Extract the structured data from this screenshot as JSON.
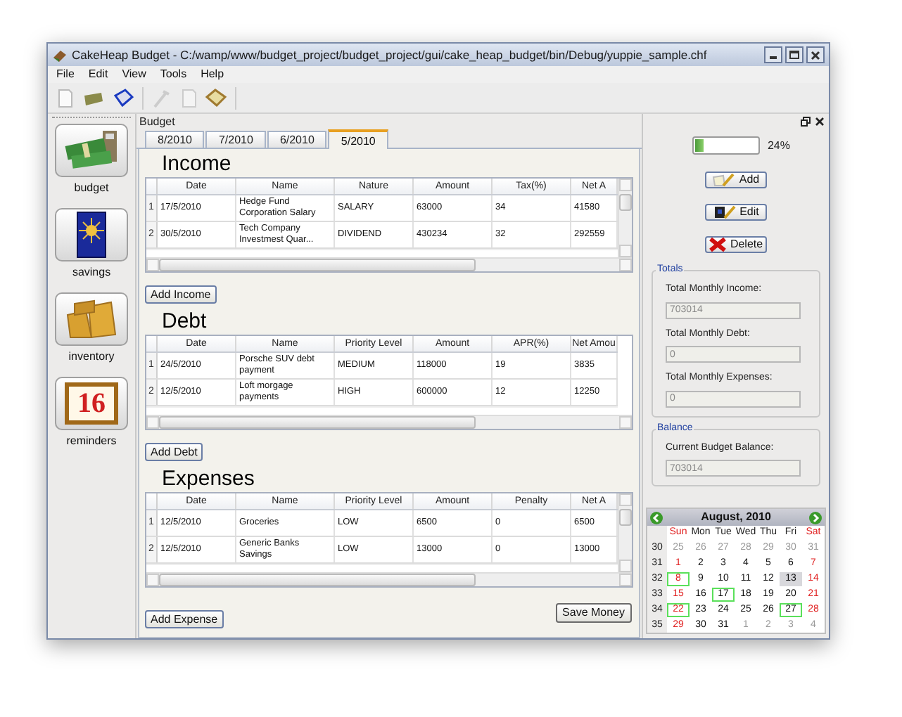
{
  "window": {
    "title": "CakeHeap Budget - C:/wamp/www/budget_project/budget_project/gui/cake_heap_budget/bin/Debug/yuppie_sample.chf"
  },
  "menu": [
    "File",
    "Edit",
    "View",
    "Tools",
    "Help"
  ],
  "sidebar": [
    {
      "label": "budget",
      "kind": "money"
    },
    {
      "label": "savings",
      "kind": "card"
    },
    {
      "label": "inventory",
      "kind": "boxes"
    },
    {
      "label": "reminders",
      "kind": "calendar",
      "icon_text": "16"
    }
  ],
  "panel_title": "Budget",
  "tabs": [
    {
      "label": "8/2010",
      "selected": false
    },
    {
      "label": "7/2010",
      "selected": false
    },
    {
      "label": "6/2010",
      "selected": false
    },
    {
      "label": "5/2010",
      "selected": true
    }
  ],
  "sections": [
    {
      "title": "Income",
      "columns": [
        "Date",
        "Name",
        "Nature",
        "Amount",
        "Tax(%)",
        "Net A"
      ],
      "rows": [
        {
          "number": "1",
          "cells": [
            "17/5/2010",
            "Hedge Fund Corporation Salary",
            "SALARY",
            "63000",
            "34",
            "41580"
          ]
        },
        {
          "number": "2",
          "cells": [
            "30/5/2010",
            "Tech Company Investmest Quar...",
            "DIVIDEND",
            "430234",
            "32",
            "292559"
          ]
        }
      ],
      "vscroll": true,
      "button": "Add Income"
    },
    {
      "title": "Debt",
      "columns": [
        "Date",
        "Name",
        "Priority Level",
        "Amount",
        "APR(%)",
        "Net Amou"
      ],
      "rows": [
        {
          "number": "1",
          "cells": [
            "24/5/2010",
            "Porsche SUV debt payment",
            "MEDIUM",
            "118000",
            "19",
            "3835"
          ]
        },
        {
          "number": "2",
          "cells": [
            "12/5/2010",
            "Loft morgage payments",
            "HIGH",
            "600000",
            "12",
            "12250"
          ]
        }
      ],
      "vscroll": false,
      "button": "Add Debt"
    },
    {
      "title": "Expenses",
      "columns": [
        "Date",
        "Name",
        "Priority Level",
        "Amount",
        "Penalty",
        "Net A"
      ],
      "rows": [
        {
          "number": "1",
          "cells": [
            "12/5/2010",
            "Groceries",
            "LOW",
            "6500",
            "0",
            "6500"
          ]
        },
        {
          "number": "2",
          "cells": [
            "12/5/2010",
            "Generic Banks Savings",
            "LOW",
            "13000",
            "0",
            "13000"
          ]
        }
      ],
      "vscroll": true,
      "button": "Add Expense"
    }
  ],
  "save_button": "Save Money",
  "progress": {
    "level": 0.12,
    "reading": "24%"
  },
  "actions": [
    {
      "label": "Add",
      "kind": "add"
    },
    {
      "label": "Edit",
      "kind": "edit"
    },
    {
      "label": "Delete",
      "kind": "delete"
    }
  ],
  "totals": {
    "title": "Totals",
    "fields": [
      {
        "label": "Total Monthly Income:",
        "value": "703014"
      },
      {
        "label": "Total Monthly Debt:",
        "value": "0"
      },
      {
        "label": "Total Monthly Expenses:",
        "value": "0"
      }
    ]
  },
  "balance": {
    "title": "Balance",
    "fields": [
      {
        "label": "Current Budget Balance:",
        "value": "703014"
      }
    ]
  },
  "calendar": {
    "month": "August, 2010",
    "weekdays": [
      "Sun",
      "Mon",
      "Tue",
      "Wed",
      "Thu",
      "Fri",
      "Sat"
    ],
    "weeks": [
      {
        "number": "30",
        "days": [
          {
            "label": "25",
            "kind": "other",
            "marked": false,
            "selected": false
          },
          {
            "label": "26",
            "kind": "other",
            "marked": false,
            "selected": false
          },
          {
            "label": "27",
            "kind": "other",
            "marked": false,
            "selected": false
          },
          {
            "label": "28",
            "kind": "other",
            "marked": false,
            "selected": false
          },
          {
            "label": "29",
            "kind": "other",
            "marked": false,
            "selected": false
          },
          {
            "label": "30",
            "kind": "other",
            "marked": false,
            "selected": false
          },
          {
            "label": "31",
            "kind": "other",
            "marked": false,
            "selected": false
          }
        ]
      },
      {
        "number": "31",
        "days": [
          {
            "label": "1",
            "kind": "day",
            "marked": false,
            "selected": false
          },
          {
            "label": "2",
            "kind": "day",
            "marked": false,
            "selected": false
          },
          {
            "label": "3",
            "kind": "day",
            "marked": false,
            "selected": false
          },
          {
            "label": "4",
            "kind": "day",
            "marked": false,
            "selected": false
          },
          {
            "label": "5",
            "kind": "day",
            "marked": false,
            "selected": false
          },
          {
            "label": "6",
            "kind": "day",
            "marked": false,
            "selected": false
          },
          {
            "label": "7",
            "kind": "day",
            "marked": false,
            "selected": false
          }
        ]
      },
      {
        "number": "32",
        "days": [
          {
            "label": "8",
            "kind": "day",
            "marked": true,
            "selected": false
          },
          {
            "label": "9",
            "kind": "day",
            "marked": false,
            "selected": false
          },
          {
            "label": "10",
            "kind": "day",
            "marked": false,
            "selected": false
          },
          {
            "label": "11",
            "kind": "day",
            "marked": false,
            "selected": false
          },
          {
            "label": "12",
            "kind": "day",
            "marked": false,
            "selected": false
          },
          {
            "label": "13",
            "kind": "day",
            "marked": false,
            "selected": true
          },
          {
            "label": "14",
            "kind": "day",
            "marked": false,
            "selected": false
          }
        ]
      },
      {
        "number": "33",
        "days": [
          {
            "label": "15",
            "kind": "day",
            "marked": false,
            "selected": false
          },
          {
            "label": "16",
            "kind": "day",
            "marked": false,
            "selected": false
          },
          {
            "label": "17",
            "kind": "day",
            "marked": true,
            "selected": false
          },
          {
            "label": "18",
            "kind": "day",
            "marked": false,
            "selected": false
          },
          {
            "label": "19",
            "kind": "day",
            "marked": false,
            "selected": false
          },
          {
            "label": "20",
            "kind": "day",
            "marked": false,
            "selected": false
          },
          {
            "label": "21",
            "kind": "day",
            "marked": false,
            "selected": false
          }
        ]
      },
      {
        "number": "34",
        "days": [
          {
            "label": "22",
            "kind": "day",
            "marked": true,
            "selected": false
          },
          {
            "label": "23",
            "kind": "day",
            "marked": false,
            "selected": false
          },
          {
            "label": "24",
            "kind": "day",
            "marked": false,
            "selected": false
          },
          {
            "label": "25",
            "kind": "day",
            "marked": false,
            "selected": false
          },
          {
            "label": "26",
            "kind": "day",
            "marked": false,
            "selected": false
          },
          {
            "label": "27",
            "kind": "day",
            "marked": true,
            "selected": false
          },
          {
            "label": "28",
            "kind": "day",
            "marked": false,
            "selected": false
          }
        ]
      },
      {
        "number": "35",
        "days": [
          {
            "label": "29",
            "kind": "day",
            "marked": false,
            "selected": false
          },
          {
            "label": "30",
            "kind": "day",
            "marked": false,
            "selected": false
          },
          {
            "label": "31",
            "kind": "day",
            "marked": false,
            "selected": false
          },
          {
            "label": "1",
            "kind": "other",
            "marked": false,
            "selected": false
          },
          {
            "label": "2",
            "kind": "other",
            "marked": false,
            "selected": false
          },
          {
            "label": "3",
            "kind": "other",
            "marked": false,
            "selected": false
          },
          {
            "label": "4",
            "kind": "other",
            "marked": false,
            "selected": false
          }
        ]
      }
    ]
  }
}
